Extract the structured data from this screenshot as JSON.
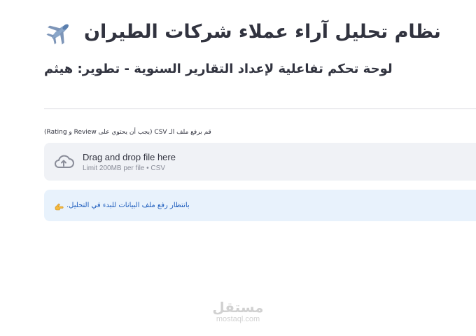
{
  "header": {
    "title": "نظام تحليل آراء عملاء شركات الطيران",
    "title_icon": "airplane-icon",
    "subtitle": "لوحة تحكم تفاعلية لإعداد التقارير السنوية - تطوير: هيثم"
  },
  "uploader": {
    "label": "قم برفع ملف الـ CSV (يجب أن يحتوي على Review و Rating)",
    "icon": "cloud-upload-icon",
    "drag_text": "Drag and drop file here",
    "limit_text": "Limit 200MB per file • CSV"
  },
  "info": {
    "message": "بانتظار رفع ملف البيانات للبدء في التحليل.",
    "icon": "pointing-hand-icon"
  },
  "watermark": {
    "logo_text": "مستقل",
    "url": "mostaql.com"
  },
  "colors": {
    "text": "#31333f",
    "dropzone_bg": "#f0f2f6",
    "info_bg": "#e8f2fc",
    "info_text": "#1c5cbd",
    "muted": "#8a8d99"
  }
}
